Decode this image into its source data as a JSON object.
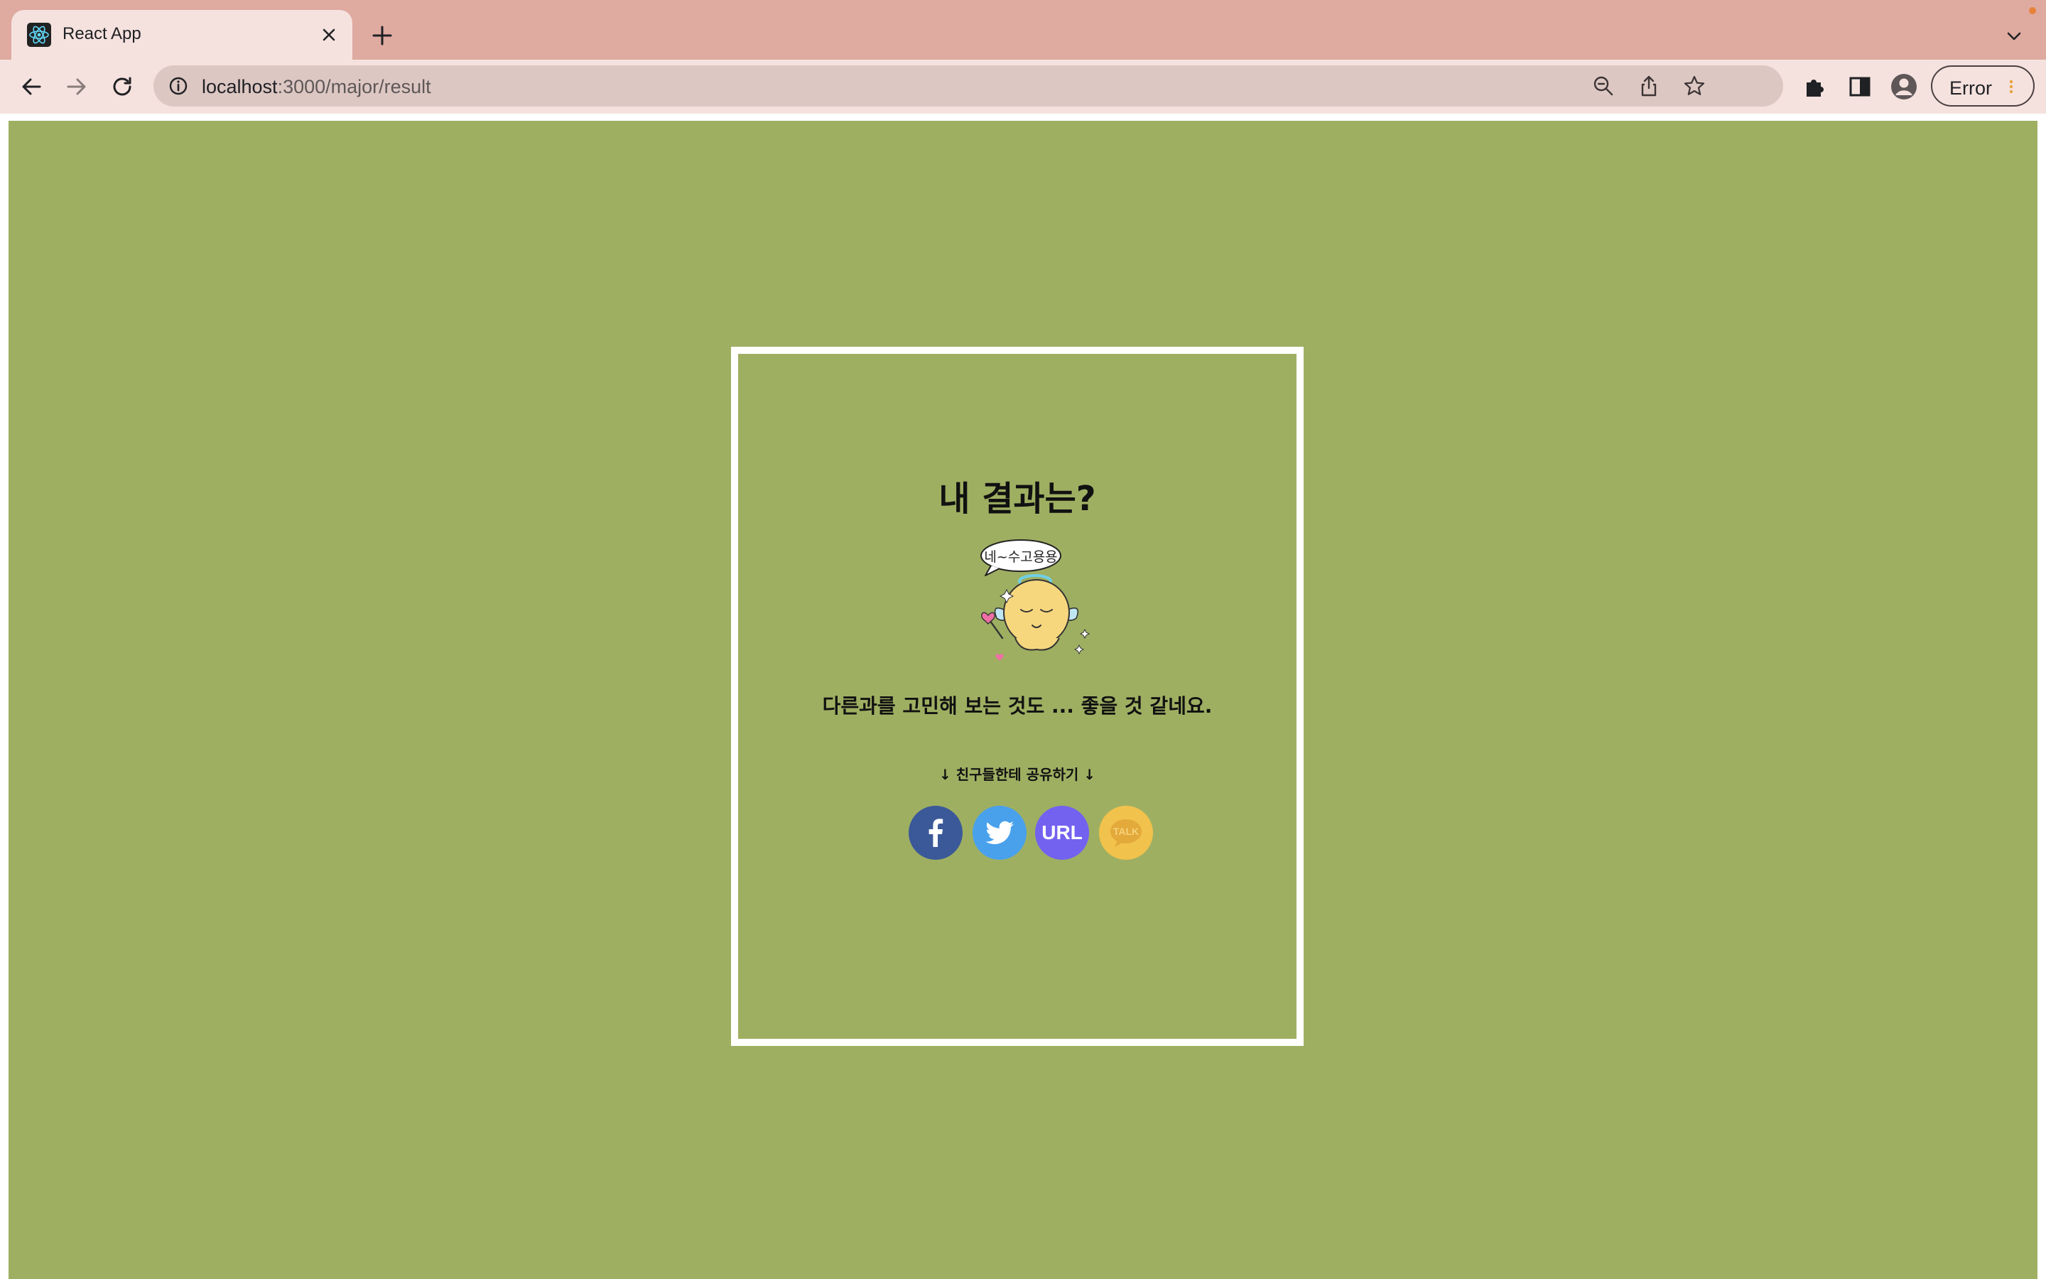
{
  "browser": {
    "tab_title": "React App",
    "url_host": "localhost",
    "url_path": ":3000/major/result",
    "profile_status": "Error",
    "chrome_color": "#dfaaa0",
    "toolbar_color": "#f5e2df"
  },
  "page": {
    "background_color": "#9faf62",
    "title": "내 결과는?",
    "mascot_speech": "네~수고용용",
    "message": "다른과를 고민해 보는 것도 ... 좋을 것 같네요.",
    "share_caption": "↓ 친구들한테 공유하기 ↓",
    "share_buttons": [
      {
        "name": "facebook",
        "icon": "facebook-icon",
        "color": "#3b5998"
      },
      {
        "name": "twitter",
        "icon": "twitter-icon",
        "color": "#49a1eb"
      },
      {
        "name": "url",
        "label": "URL",
        "color": "#7362f0"
      },
      {
        "name": "kakao",
        "label": "TALK",
        "color": "#f1c24c"
      }
    ]
  }
}
